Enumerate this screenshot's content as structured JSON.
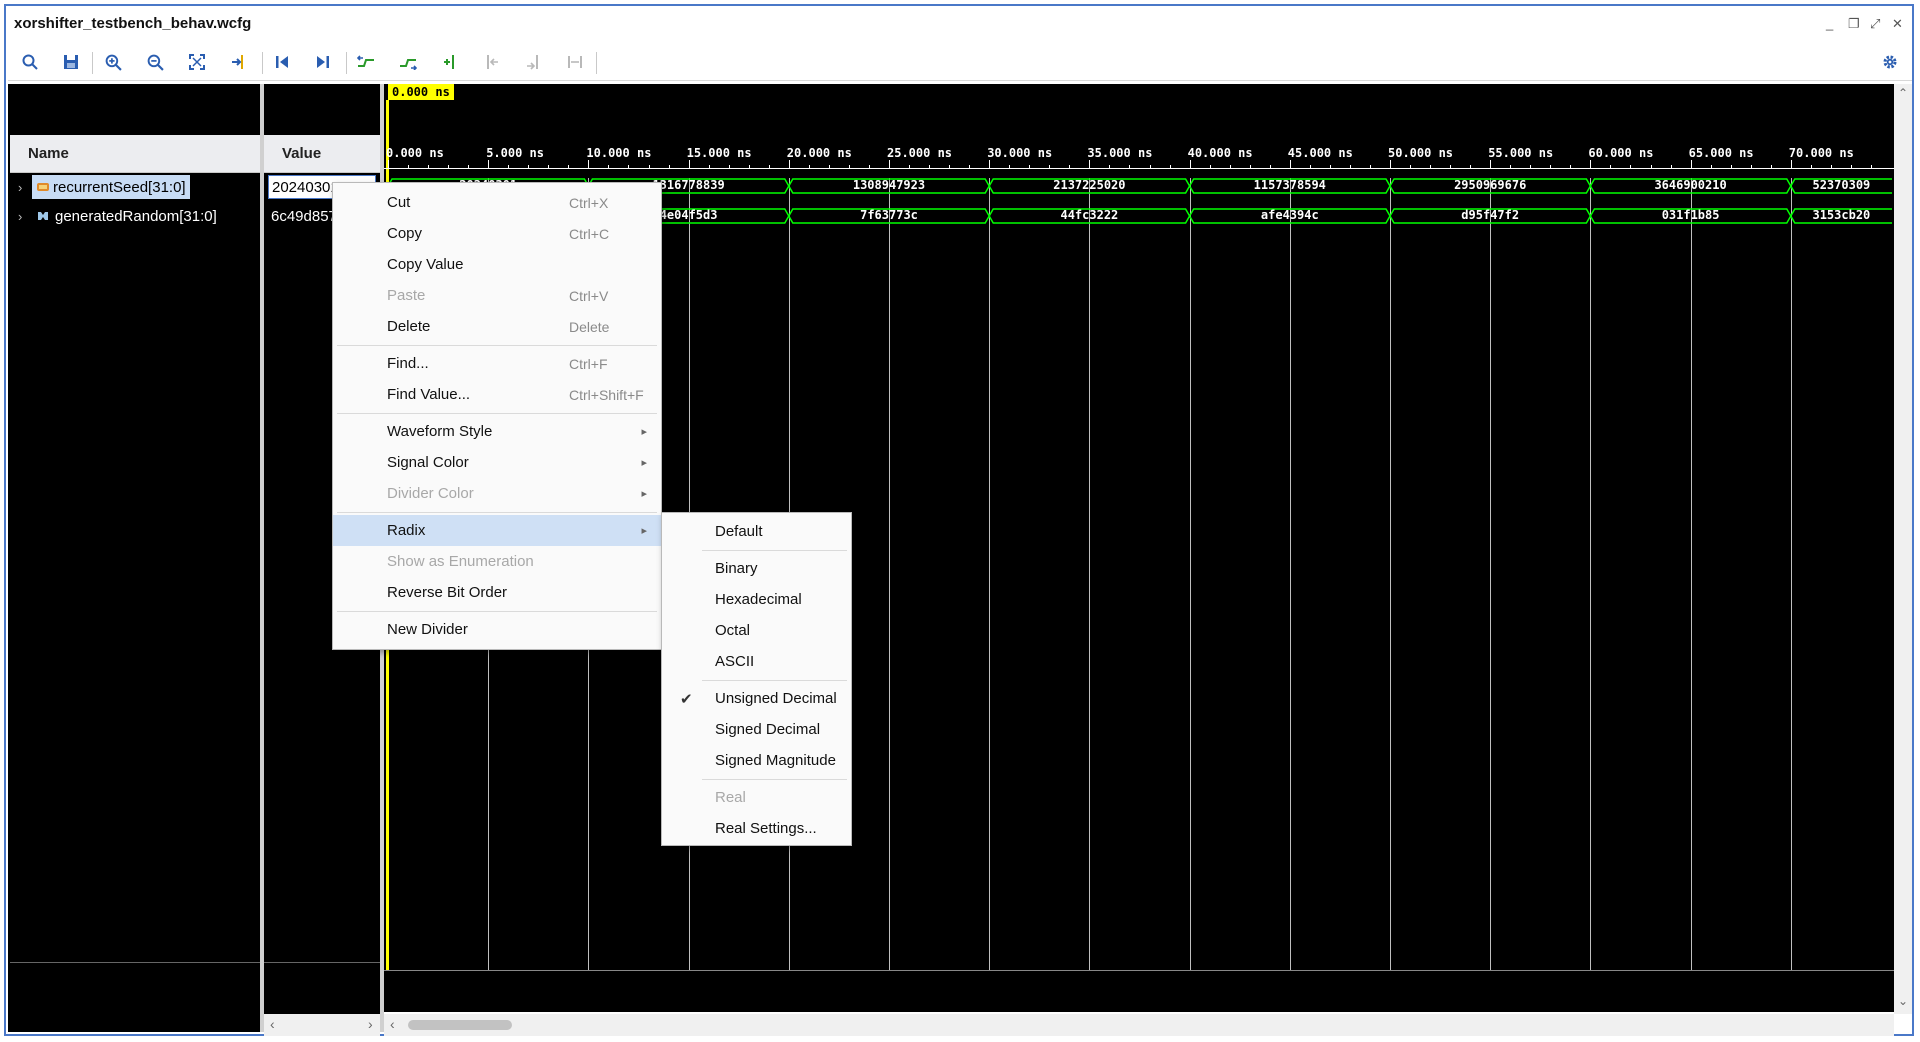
{
  "window": {
    "title": "xorshifter_testbench_behav.wcfg",
    "controls": [
      "_",
      "❐",
      "⤢",
      "✕"
    ]
  },
  "toolbar": {
    "icons": [
      "search-icon",
      "save-icon",
      "zoom-in-icon",
      "zoom-out-icon",
      "zoom-fit-icon",
      "goto-cursor-icon",
      "go-to-start-icon",
      "go-to-end-icon",
      "previous-transition-icon",
      "next-transition-icon",
      "add-marker-icon",
      "previous-marker-icon",
      "next-marker-icon",
      "swap-cursors-icon"
    ],
    "settings_icon": "gear-icon"
  },
  "columns": {
    "name": "Name",
    "value": "Value"
  },
  "signals": [
    {
      "name": "recurrentSeed[31:0]",
      "value": "20240301",
      "icon": "bus-icon",
      "selected": true
    },
    {
      "name": "generatedRandom[31:0]",
      "value": "6c49d857",
      "icon": "bus-icon",
      "selected": false
    }
  ],
  "waveform": {
    "cursor_time": "0.000 ns",
    "ticks": [
      "0.000 ns",
      "5.000 ns",
      "10.000 ns",
      "15.000 ns",
      "20.000 ns",
      "25.000 ns",
      "30.000 ns",
      "35.000 ns",
      "40.000 ns",
      "45.000 ns",
      "50.000 ns",
      "55.000 ns",
      "60.000 ns",
      "65.000 ns",
      "70.000 ns"
    ],
    "wave_color": "#00ff00",
    "seed_values": [
      "20240301",
      "1316778839",
      "1308947923",
      "2137225020",
      "1157378594",
      "2950969676",
      "3646900210",
      "52370309"
    ],
    "random_values": [
      "6c49d857",
      "4e04f5d3",
      "7f63773c",
      "44fc3222",
      "afe4394c",
      "d95f47f2",
      "031f1b85",
      "3153cb20"
    ]
  },
  "context_menu": {
    "items": [
      {
        "label": "Cut",
        "shortcut": "Ctrl+X",
        "enabled": true
      },
      {
        "label": "Copy",
        "shortcut": "Ctrl+C",
        "enabled": true
      },
      {
        "label": "Copy Value",
        "shortcut": "",
        "enabled": true
      },
      {
        "label": "Paste",
        "shortcut": "Ctrl+V",
        "enabled": false
      },
      {
        "label": "Delete",
        "shortcut": "Delete",
        "enabled": true
      },
      {
        "label": "Find...",
        "shortcut": "Ctrl+F",
        "enabled": true
      },
      {
        "label": "Find Value...",
        "shortcut": "Ctrl+Shift+F",
        "enabled": true
      },
      {
        "label": "Waveform Style",
        "shortcut": "",
        "enabled": true,
        "submenu": true
      },
      {
        "label": "Signal Color",
        "shortcut": "",
        "enabled": true,
        "submenu": true
      },
      {
        "label": "Divider Color",
        "shortcut": "",
        "enabled": false,
        "submenu": true
      },
      {
        "label": "Radix",
        "shortcut": "",
        "enabled": true,
        "submenu": true,
        "highlighted": true
      },
      {
        "label": "Show as Enumeration",
        "shortcut": "",
        "enabled": false
      },
      {
        "label": "Reverse Bit Order",
        "shortcut": "",
        "enabled": true
      },
      {
        "label": "New Divider",
        "shortcut": "",
        "enabled": true
      }
    ]
  },
  "radix_menu": {
    "items": [
      {
        "label": "Default",
        "enabled": true,
        "checked": false
      },
      {
        "label": "Binary",
        "enabled": true,
        "checked": false
      },
      {
        "label": "Hexadecimal",
        "enabled": true,
        "checked": false
      },
      {
        "label": "Octal",
        "enabled": true,
        "checked": false
      },
      {
        "label": "ASCII",
        "enabled": true,
        "checked": false
      },
      {
        "label": "Unsigned Decimal",
        "enabled": true,
        "checked": true
      },
      {
        "label": "Signed Decimal",
        "enabled": true,
        "checked": false
      },
      {
        "label": "Signed Magnitude",
        "enabled": true,
        "checked": false
      },
      {
        "label": "Real",
        "enabled": false,
        "checked": false
      },
      {
        "label": "Real Settings...",
        "enabled": true,
        "checked": false
      }
    ]
  }
}
